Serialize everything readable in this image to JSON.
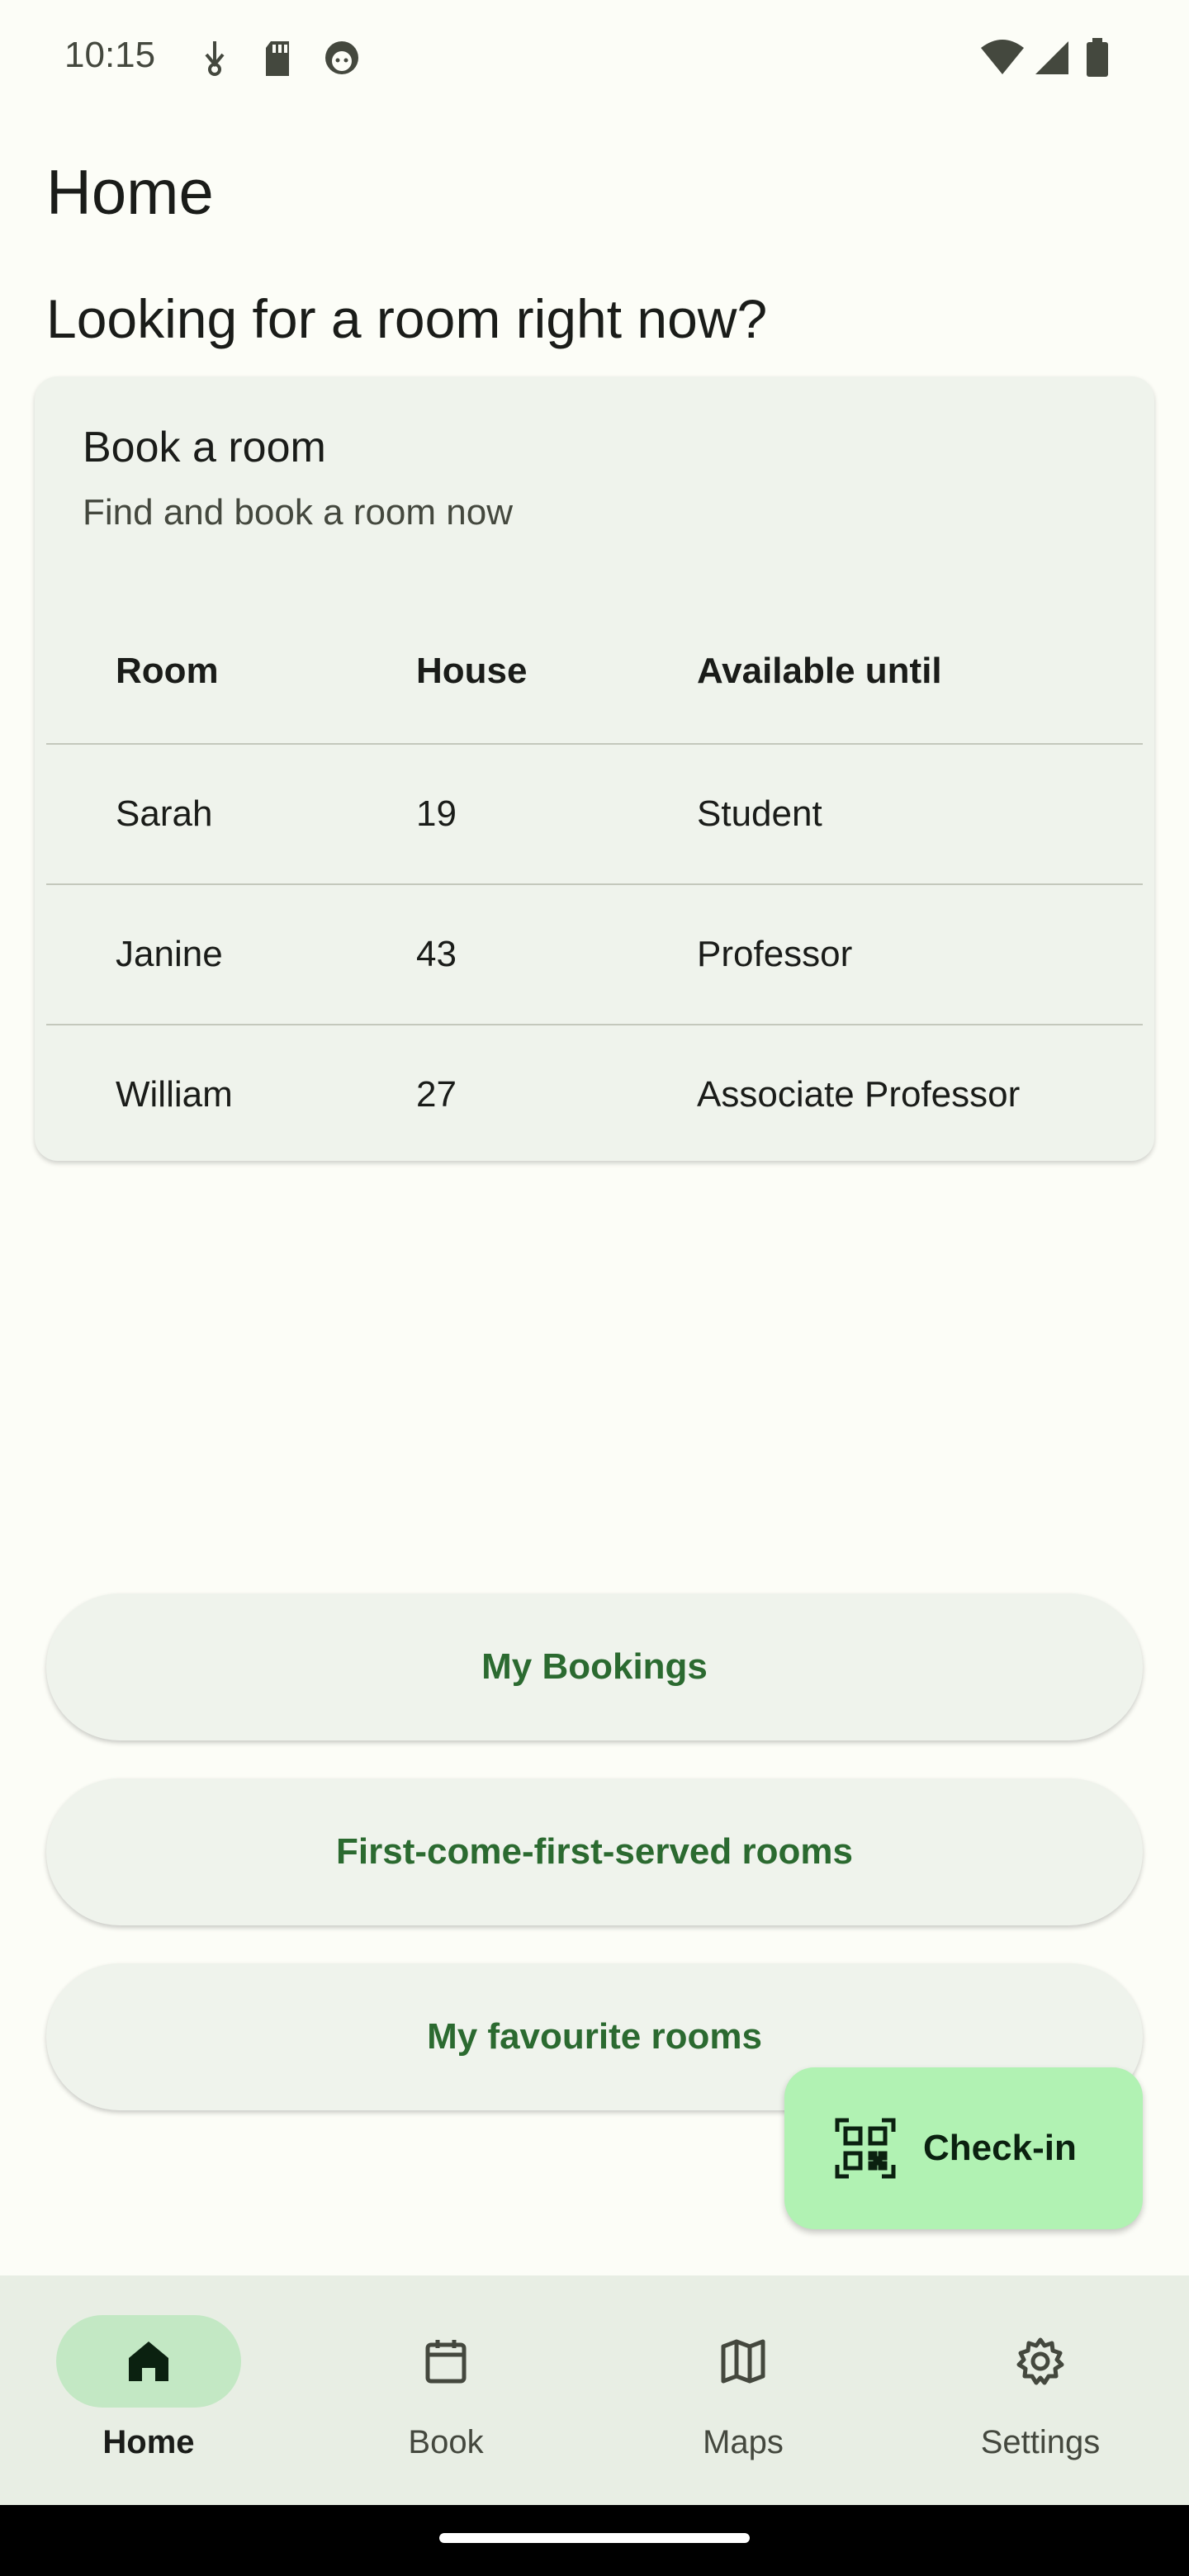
{
  "status_bar": {
    "time": "10:15",
    "left_icons": [
      "usb-debug-icon",
      "sd-card-icon",
      "android-face-icon"
    ],
    "right_icons": [
      "wifi-icon",
      "cell-signal-icon",
      "battery-icon"
    ]
  },
  "header": {
    "title": "Home"
  },
  "section": {
    "title": "Looking for a room right now?"
  },
  "book_card": {
    "title": "Book a room",
    "subtitle": "Find and book a room now",
    "columns": [
      "Room",
      "House",
      "Available until"
    ],
    "rows": [
      [
        "Sarah",
        "19",
        "Student"
      ],
      [
        "Janine",
        "43",
        "Professor"
      ],
      [
        "William",
        "27",
        "Associate Professor"
      ]
    ]
  },
  "actions": {
    "my_bookings": "My Bookings",
    "first_come": "First-come-first-served rooms",
    "favourites": "My favourite rooms"
  },
  "fab": {
    "label": "Check-in",
    "icon": "qr-code-scan-icon"
  },
  "nav": {
    "items": [
      {
        "label": "Home",
        "icon": "home-icon",
        "active": true
      },
      {
        "label": "Book",
        "icon": "calendar-icon",
        "active": false
      },
      {
        "label": "Maps",
        "icon": "map-icon",
        "active": false
      },
      {
        "label": "Settings",
        "icon": "gear-icon",
        "active": false
      }
    ]
  },
  "colors": {
    "background": "#fcfdf7",
    "card": "#eff3ec",
    "accent_text": "#2b6a30",
    "fab": "#b1f2b3",
    "nav_indicator": "#c3e8c4",
    "nav_bar": "#e8eee4"
  }
}
